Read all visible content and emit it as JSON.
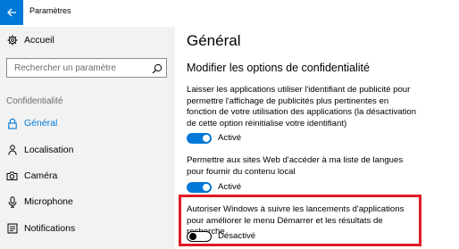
{
  "window": {
    "title": "Paramètres",
    "back_icon": "arrow-left-icon"
  },
  "sidebar": {
    "home_label": "Accueil",
    "search_placeholder": "Rechercher un paramètre",
    "section_label": "Confidentialité",
    "items": [
      {
        "label": "Général",
        "icon": "lock-icon",
        "selected": true
      },
      {
        "label": "Localisation",
        "icon": "location-person-icon"
      },
      {
        "label": "Caméra",
        "icon": "camera-icon"
      },
      {
        "label": "Microphone",
        "icon": "microphone-icon"
      },
      {
        "label": "Notifications",
        "icon": "notifications-icon"
      }
    ]
  },
  "main": {
    "title": "Général",
    "section_title": "Modifier les options de confidentialité",
    "settings": [
      {
        "description": "Laisser les applications utiliser l'identifiant de publicité pour permettre l'affichage de publicités plus pertinentes en fonction de votre utilisation des applications (la désactivation de cette option réinitialise votre identifiant)",
        "state": "Activé",
        "on": true
      },
      {
        "description": "Permettre aux sites Web d'accéder à ma liste de langues pour fournir du contenu local",
        "state": "Activé",
        "on": true
      },
      {
        "description": "Autoriser Windows à suivre les lancements d'applications pour améliorer le menu Démarrer et les résultats de recherche",
        "state": "Désactivé",
        "on": false,
        "highlighted": true
      }
    ]
  },
  "colors": {
    "accent": "#0078d7",
    "highlight": "#e21a23",
    "sidebar_bg": "#f2f2f2"
  }
}
